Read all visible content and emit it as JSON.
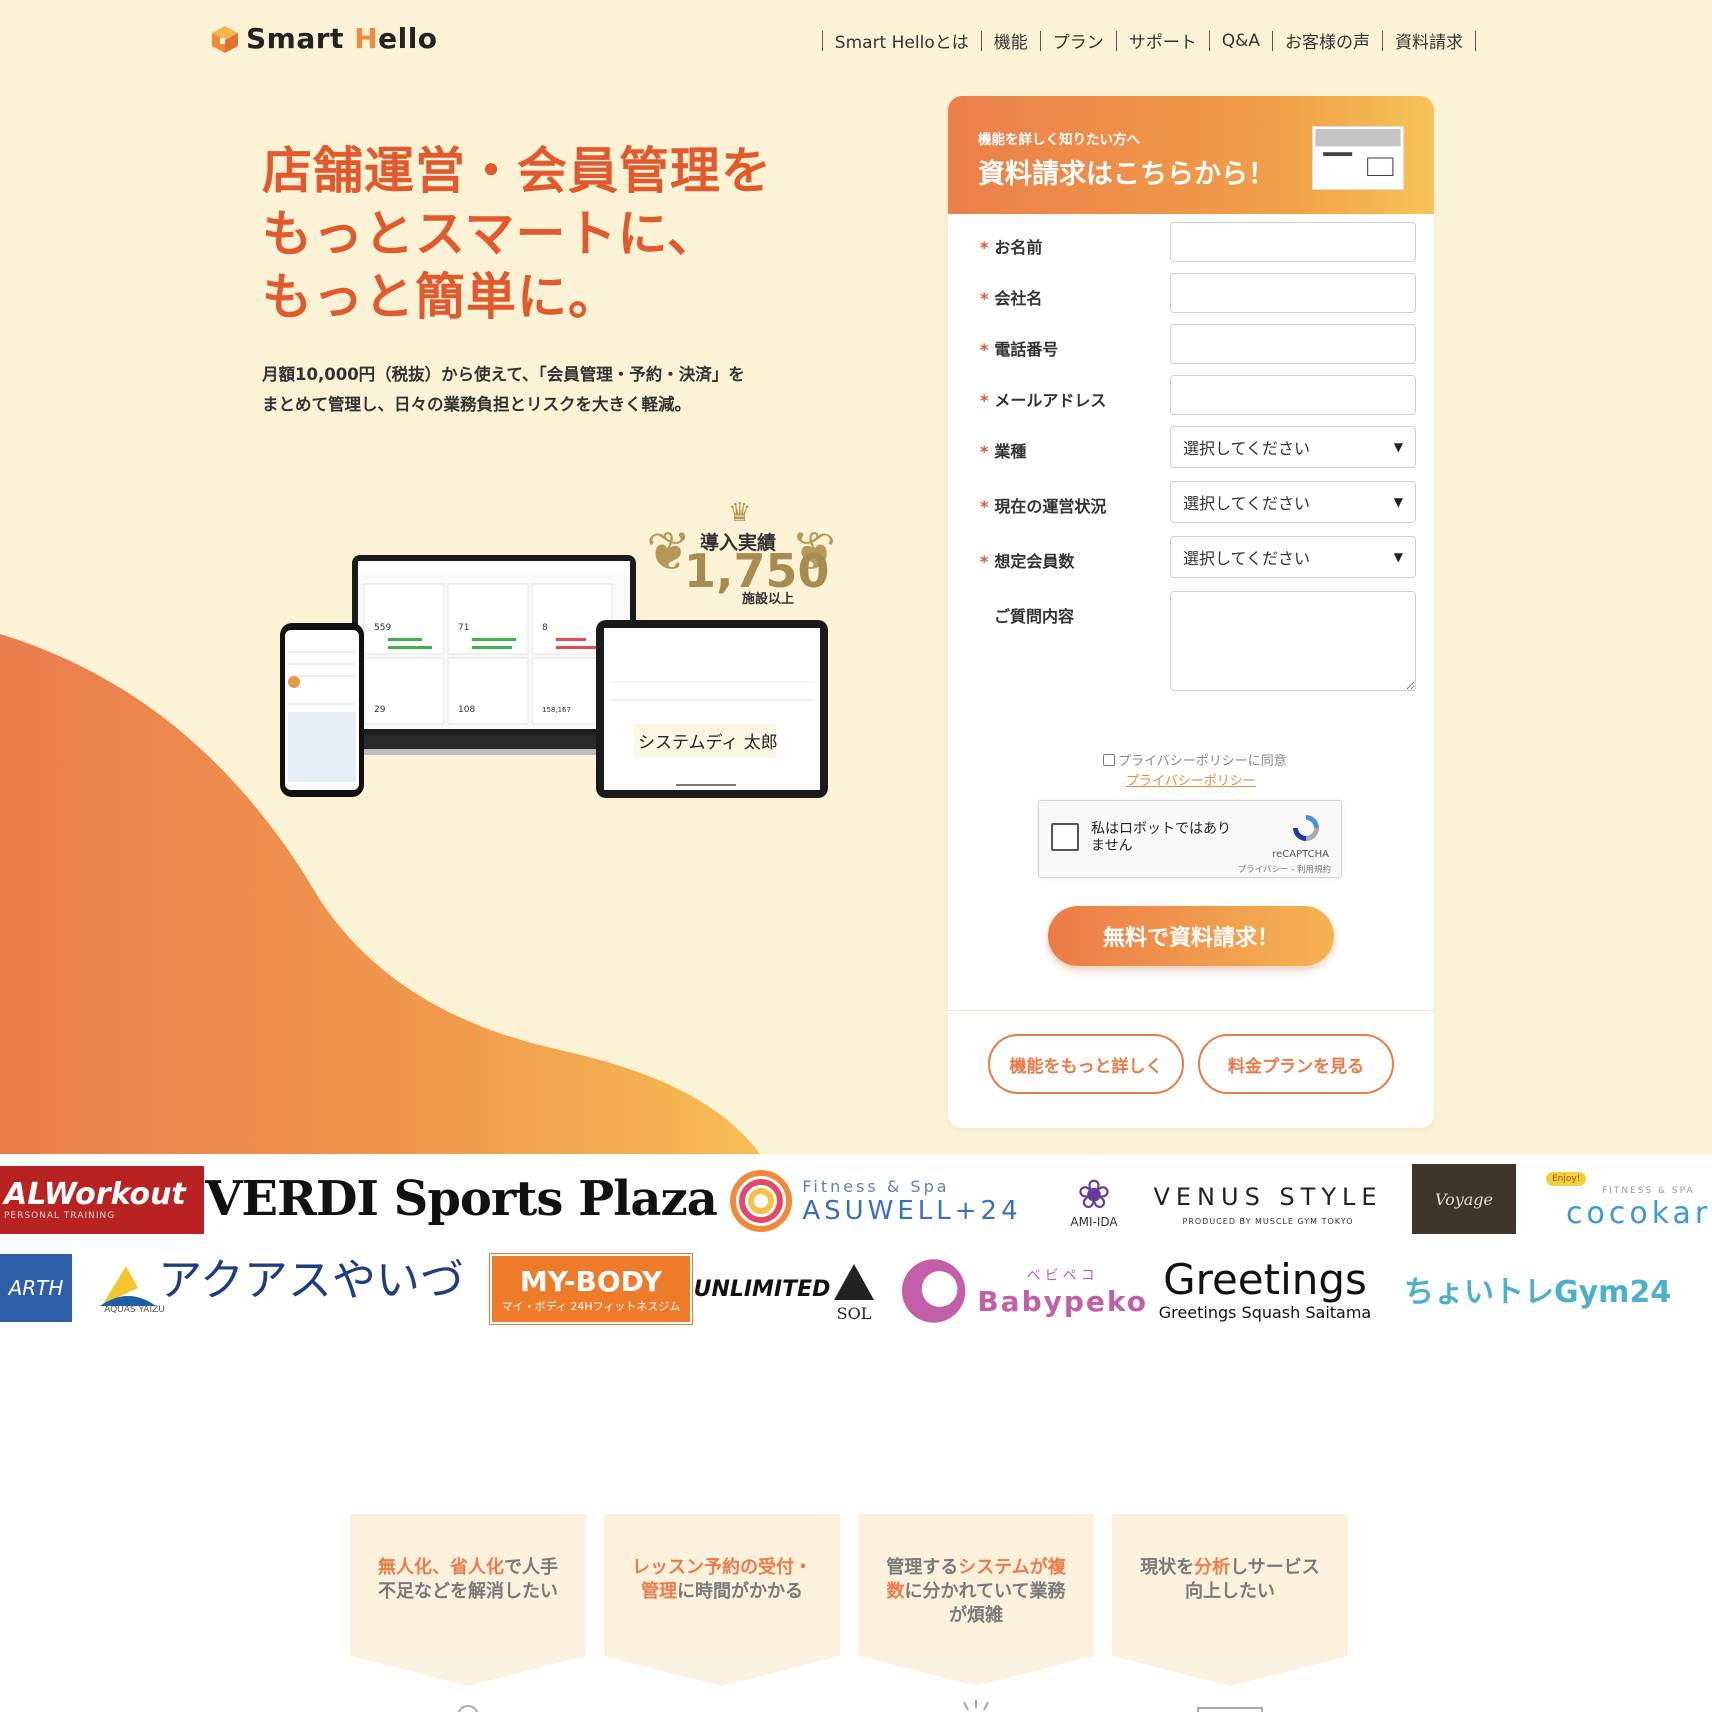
{
  "header": {
    "logo_text_a": "Smart ",
    "logo_text_b": "H",
    "logo_text_c": "ello",
    "nav": [
      "Smart Helloとは",
      "機能",
      "プラン",
      "サポート",
      "Q&A",
      "お客様の声",
      "資料請求"
    ]
  },
  "hero": {
    "headline": [
      "店舗運営・会員管理を",
      "もっとスマートに、",
      "もっと簡単に。"
    ],
    "lead": [
      "月額10,000円（税抜）から使えて、「会員管理・予約・決済」を",
      "まとめて管理し、日々の業務負担とリスクを大きく軽減。"
    ],
    "award": {
      "line1": "導入実績",
      "number": "1,750",
      "line2": "施設以上"
    },
    "signature": "システムディ 太郎",
    "dashboard_numbers": [
      "559",
      "71",
      "8",
      "29",
      "108",
      "158,167"
    ]
  },
  "form": {
    "subtitle": "機能を詳しく知りたい方へ",
    "title": "資料請求はこちらから！",
    "fields": [
      {
        "label": "お名前",
        "required": true,
        "type": "text",
        "value": ""
      },
      {
        "label": "会社名",
        "required": true,
        "type": "text",
        "value": ""
      },
      {
        "label": "電話番号",
        "required": true,
        "type": "text",
        "value": ""
      },
      {
        "label": "メールアドレス",
        "required": true,
        "type": "text",
        "value": ""
      },
      {
        "label": "業種",
        "required": true,
        "type": "select",
        "value": "選択してください"
      },
      {
        "label": "現在の運営状況",
        "required": true,
        "type": "select",
        "value": "選択してください"
      },
      {
        "label": "想定会員数",
        "required": true,
        "type": "select",
        "value": "選択してください"
      },
      {
        "label": "ご質問内容",
        "required": false,
        "type": "textarea",
        "value": ""
      }
    ],
    "required_mark": "*",
    "consent": "プライバシーポリシーに同意",
    "privacy_link": "プライバシーポリシー",
    "captcha": {
      "text": "私はロボットではありません",
      "brand": "reCAPTCHA",
      "terms": "プライバシー - 利用規約"
    },
    "submit": "無料で資料請求！",
    "btn_features": "機能をもっと詳しく",
    "btn_plans": "料金プランを見る"
  },
  "logos": {
    "row1": [
      "ALWorkout",
      "PERSONAL TRAINING",
      "VERDI Sports Plaza",
      "Fitness & Spa",
      "ASUWELL+24",
      "AMI-IDA",
      "VENUS STYLE",
      "PRODUCED BY MUSCLE GYM TOKYO",
      "Voyage",
      "Enjoy!",
      "FITNESS & SPA",
      "cocokar"
    ],
    "row2": [
      "ARTH",
      "アクアスやいづ",
      "AQUAS YAIZU",
      "MY-BODY",
      "マイ・ボディ 24Hフィットネスジム",
      "UNLIMITED",
      "SOL",
      "ベビペコ",
      "Babypeko",
      "Greetings",
      "Greetings Squash Saitama",
      "ちょいトレGym24"
    ]
  },
  "problems": [
    {
      "parts": [
        [
          "無人化、省人化",
          true
        ],
        [
          "で人手",
          false
        ]
      ],
      "line2": [
        [
          "不足などを解消したい",
          false
        ]
      ]
    },
    {
      "parts": [
        [
          "レッスン予約の受付・",
          true
        ]
      ],
      "line2": [
        [
          "管理",
          true
        ],
        [
          "に時間がかかる",
          false
        ]
      ]
    },
    {
      "parts": [
        [
          "管理する",
          false
        ],
        [
          "システムが複",
          true
        ]
      ],
      "line2": [
        [
          "数",
          true
        ],
        [
          "に分かれていて業務",
          false
        ]
      ],
      "line3": "が煩雑"
    },
    {
      "parts": [
        [
          "現状を",
          false
        ],
        [
          "分析",
          true
        ],
        [
          "しサービス",
          false
        ]
      ],
      "line2": [
        [
          "向上したい",
          false
        ]
      ]
    }
  ],
  "colors": {
    "accent": "#e05a2e",
    "orange": "#ee8a3a",
    "hero_bg": "#fcf3d6"
  }
}
